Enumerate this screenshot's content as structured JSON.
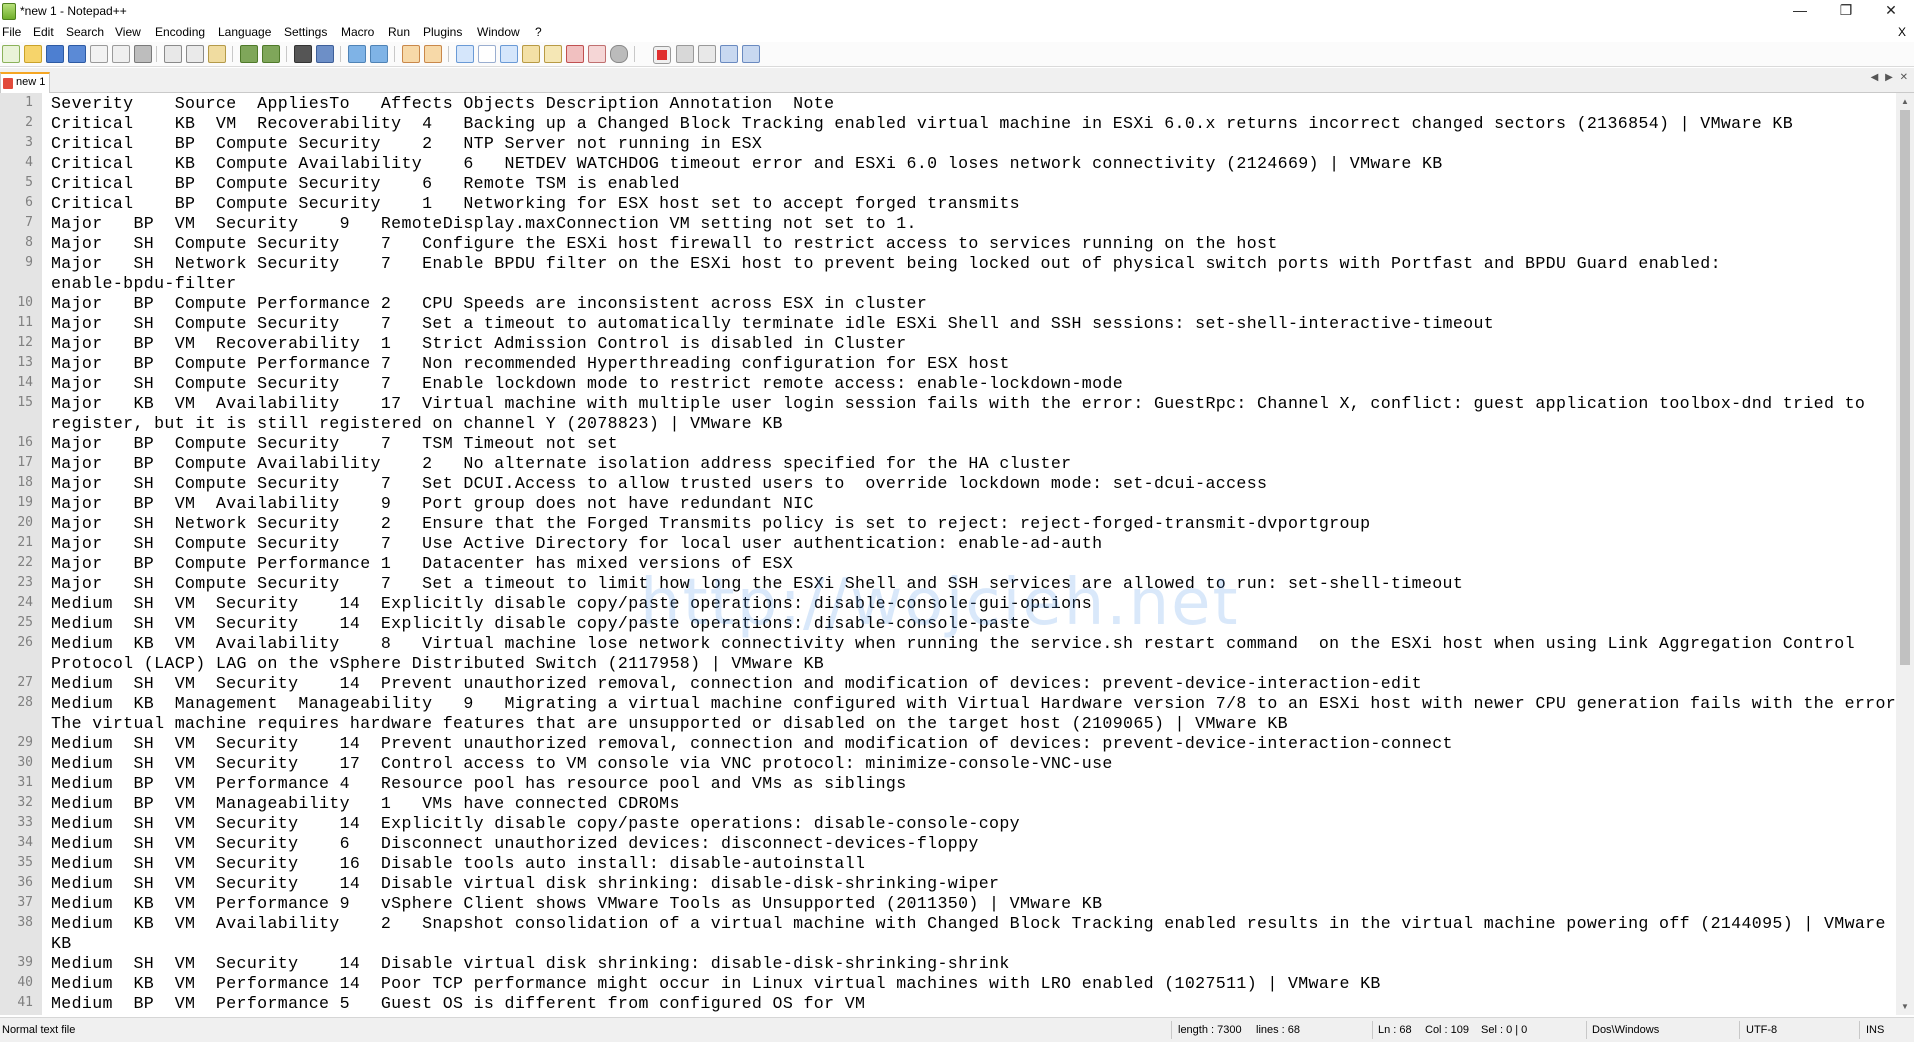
{
  "window": {
    "title": "*new 1 - Notepad++",
    "minimize": "—",
    "maximize": "❐",
    "close": "✕"
  },
  "menu": {
    "items": [
      "File",
      "Edit",
      "Search",
      "View",
      "Encoding",
      "Language",
      "Settings",
      "Macro",
      "Run",
      "Plugins",
      "Window",
      "?"
    ],
    "close_x": "X"
  },
  "tab": {
    "label": "new 1",
    "arrows": "◀ ▶ ✕"
  },
  "watermark": "http://wojcieh.net",
  "editor_lines": [
    {
      "n": "1",
      "t": "Severity    Source  AppliesTo   Affects Objects Description Annotation  Note"
    },
    {
      "n": "2",
      "t": "Critical    KB  VM  Recoverability  4   Backing up a Changed Block Tracking enabled virtual machine in ESXi 6.0.x returns incorrect changed sectors (2136854) | VMware KB"
    },
    {
      "n": "3",
      "t": "Critical    BP  Compute Security    2   NTP Server not running in ESX"
    },
    {
      "n": "4",
      "t": "Critical    KB  Compute Availability    6   NETDEV WATCHDOG timeout error and ESXi 6.0 loses network connectivity (2124669) | VMware KB"
    },
    {
      "n": "5",
      "t": "Critical    BP  Compute Security    6   Remote TSM is enabled"
    },
    {
      "n": "6",
      "t": "Critical    BP  Compute Security    1   Networking for ESX host set to accept forged transmits"
    },
    {
      "n": "7",
      "t": "Major   BP  VM  Security    9   RemoteDisplay.maxConnection VM setting not set to 1."
    },
    {
      "n": "8",
      "t": "Major   SH  Compute Security    7   Configure the ESXi host firewall to restrict access to services running on the host"
    },
    {
      "n": "9",
      "t": "Major   SH  Network Security    7   Enable BPDU filter on the ESXi host to prevent being locked out of physical switch ports with Portfast and BPDU Guard enabled:"
    },
    {
      "n": "",
      "t": "enable-bpdu-filter"
    },
    {
      "n": "10",
      "t": "Major   BP  Compute Performance 2   CPU Speeds are inconsistent across ESX in cluster"
    },
    {
      "n": "11",
      "t": "Major   SH  Compute Security    7   Set a timeout to automatically terminate idle ESXi Shell and SSH sessions: set-shell-interactive-timeout"
    },
    {
      "n": "12",
      "t": "Major   BP  VM  Recoverability  1   Strict Admission Control is disabled in Cluster"
    },
    {
      "n": "13",
      "t": "Major   BP  Compute Performance 7   Non recommended Hyperthreading configuration for ESX host"
    },
    {
      "n": "14",
      "t": "Major   SH  Compute Security    7   Enable lockdown mode to restrict remote access: enable-lockdown-mode"
    },
    {
      "n": "15",
      "t": "Major   KB  VM  Availability    17  Virtual machine with multiple user login session fails with the error: GuestRpc: Channel X, conflict: guest application toolbox-dnd tried to"
    },
    {
      "n": "",
      "t": "register, but it is still registered on channel Y (2078823) | VMware KB"
    },
    {
      "n": "16",
      "t": "Major   BP  Compute Security    7   TSM Timeout not set"
    },
    {
      "n": "17",
      "t": "Major   BP  Compute Availability    2   No alternate isolation address specified for the HA cluster"
    },
    {
      "n": "18",
      "t": "Major   SH  Compute Security    7   Set DCUI.Access to allow trusted users to  override lockdown mode: set-dcui-access"
    },
    {
      "n": "19",
      "t": "Major   BP  VM  Availability    9   Port group does not have redundant NIC"
    },
    {
      "n": "20",
      "t": "Major   SH  Network Security    2   Ensure that the Forged Transmits policy is set to reject: reject-forged-transmit-dvportgroup"
    },
    {
      "n": "21",
      "t": "Major   SH  Compute Security    7   Use Active Directory for local user authentication: enable-ad-auth"
    },
    {
      "n": "22",
      "t": "Major   BP  Compute Performance 1   Datacenter has mixed versions of ESX"
    },
    {
      "n": "23",
      "t": "Major   SH  Compute Security    7   Set a timeout to limit how long the ESXi Shell and SSH services are allowed to run: set-shell-timeout"
    },
    {
      "n": "24",
      "t": "Medium  SH  VM  Security    14  Explicitly disable copy/paste operations: disable-console-gui-options"
    },
    {
      "n": "25",
      "t": "Medium  SH  VM  Security    14  Explicitly disable copy/paste operations: disable-console-paste"
    },
    {
      "n": "26",
      "t": "Medium  KB  VM  Availability    8   Virtual machine lose network connectivity when running the service.sh restart command  on the ESXi host when using Link Aggregation Control"
    },
    {
      "n": "",
      "t": "Protocol (LACP) LAG on the vSphere Distributed Switch (2117958) | VMware KB"
    },
    {
      "n": "27",
      "t": "Medium  SH  VM  Security    14  Prevent unauthorized removal, connection and modification of devices: prevent-device-interaction-edit"
    },
    {
      "n": "28",
      "t": "Medium  KB  Management  Manageability   9   Migrating a virtual machine configured with Virtual Hardware version 7/8 to an ESXi host with newer CPU generation fails with the error:"
    },
    {
      "n": "",
      "t": "The virtual machine requires hardware features that are unsupported or disabled on the target host (2109065) | VMware KB"
    },
    {
      "n": "29",
      "t": "Medium  SH  VM  Security    14  Prevent unauthorized removal, connection and modification of devices: prevent-device-interaction-connect"
    },
    {
      "n": "30",
      "t": "Medium  SH  VM  Security    17  Control access to VM console via VNC protocol: minimize-console-VNC-use"
    },
    {
      "n": "31",
      "t": "Medium  BP  VM  Performance 4   Resource pool has resource pool and VMs as siblings"
    },
    {
      "n": "32",
      "t": "Medium  BP  VM  Manageability   1   VMs have connected CDROMs"
    },
    {
      "n": "33",
      "t": "Medium  SH  VM  Security    14  Explicitly disable copy/paste operations: disable-console-copy"
    },
    {
      "n": "34",
      "t": "Medium  SH  VM  Security    6   Disconnect unauthorized devices: disconnect-devices-floppy"
    },
    {
      "n": "35",
      "t": "Medium  SH  VM  Security    16  Disable tools auto install: disable-autoinstall"
    },
    {
      "n": "36",
      "t": "Medium  SH  VM  Security    14  Disable virtual disk shrinking: disable-disk-shrinking-wiper"
    },
    {
      "n": "37",
      "t": "Medium  KB  VM  Performance 9   vSphere Client shows VMware Tools as Unsupported (2011350) | VMware KB"
    },
    {
      "n": "38",
      "t": "Medium  KB  VM  Availability    2   Snapshot consolidation of a virtual machine with Changed Block Tracking enabled results in the virtual machine powering off (2144095) | VMware"
    },
    {
      "n": "",
      "t": "KB"
    },
    {
      "n": "39",
      "t": "Medium  SH  VM  Security    14  Disable virtual disk shrinking: disable-disk-shrinking-shrink"
    },
    {
      "n": "40",
      "t": "Medium  KB  VM  Performance 14  Poor TCP performance might occur in Linux virtual machines with LRO enabled (1027511) | VMware KB"
    },
    {
      "n": "41",
      "t": "Medium  BP  VM  Performance 5   Guest OS is different from configured OS for VM"
    }
  ],
  "status": {
    "file_type": "Normal text file",
    "length": "length : 7300",
    "lines": "lines : 68",
    "ln": "Ln : 68",
    "col": "Col : 109",
    "sel": "Sel : 0 | 0",
    "eol": "Dos\\Windows",
    "encoding": "UTF-8",
    "mode": "INS"
  }
}
